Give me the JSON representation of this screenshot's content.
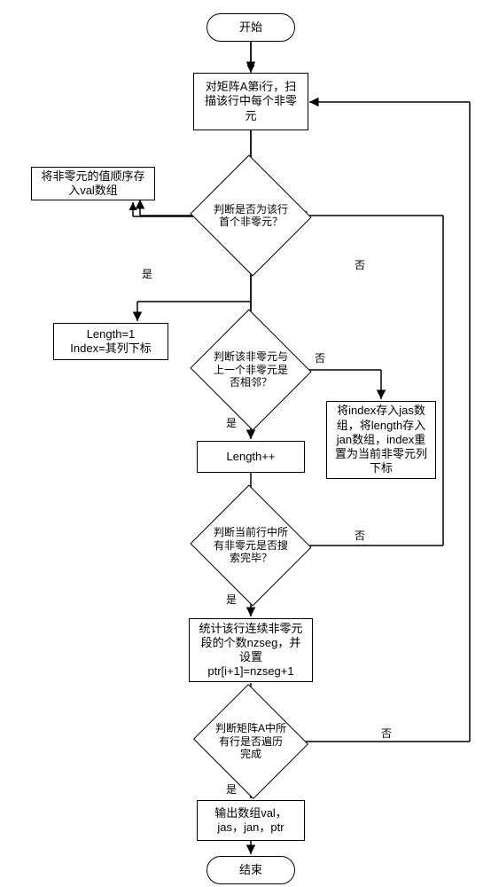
{
  "chart_data": {
    "type": "flowchart",
    "title": "",
    "nodes": {
      "start": "开始",
      "scan_row": "对矩阵A第i行，扫描该行中每个非零元",
      "store_val": "将非零元的值顺序存入val数组",
      "is_first": "判断是否为该行首个非零元？",
      "init_len": "Length=1\nIndex=其列下标",
      "is_adj": "判断该非零元与上一个非零元是否相邻？",
      "inc_len": "Length++",
      "store_idx": "将index存入jas数组，将length存入jan数组，index重置为当前非零元列下标",
      "all_scanned": "判断当前行中所有非零元是否搜索完毕？",
      "count_seg": "统计该行连续非零元段的个数nzseg，并设置ptr[i+1]=nzseg+1",
      "all_rows": "判断矩阵A中所有行是否遍历完成",
      "output": "输出数组val，jas，jan，ptr",
      "end": "结束"
    },
    "edges": [
      {
        "from": "start",
        "to": "scan_row"
      },
      {
        "from": "scan_row",
        "to": "is_first"
      },
      {
        "from": "is_first",
        "to": "store_val",
        "side": true
      },
      {
        "from": "is_first",
        "to": "init_len",
        "label": "是"
      },
      {
        "from": "is_first",
        "to": "is_adj",
        "label": "否"
      },
      {
        "from": "is_adj",
        "to": "inc_len",
        "label": "是"
      },
      {
        "from": "is_adj",
        "to": "store_idx",
        "label": "否"
      },
      {
        "from": "inc_len",
        "to": "all_scanned"
      },
      {
        "from": "all_scanned",
        "to": "count_seg",
        "label": "是"
      },
      {
        "from": "all_scanned",
        "to": "is_first",
        "label": "否",
        "back": true
      },
      {
        "from": "count_seg",
        "to": "all_rows"
      },
      {
        "from": "all_rows",
        "to": "output",
        "label": "是"
      },
      {
        "from": "all_rows",
        "to": "scan_row",
        "label": "否",
        "back": true
      },
      {
        "from": "output",
        "to": "end"
      }
    ],
    "labels": {
      "yes": "是",
      "no": "否"
    }
  }
}
